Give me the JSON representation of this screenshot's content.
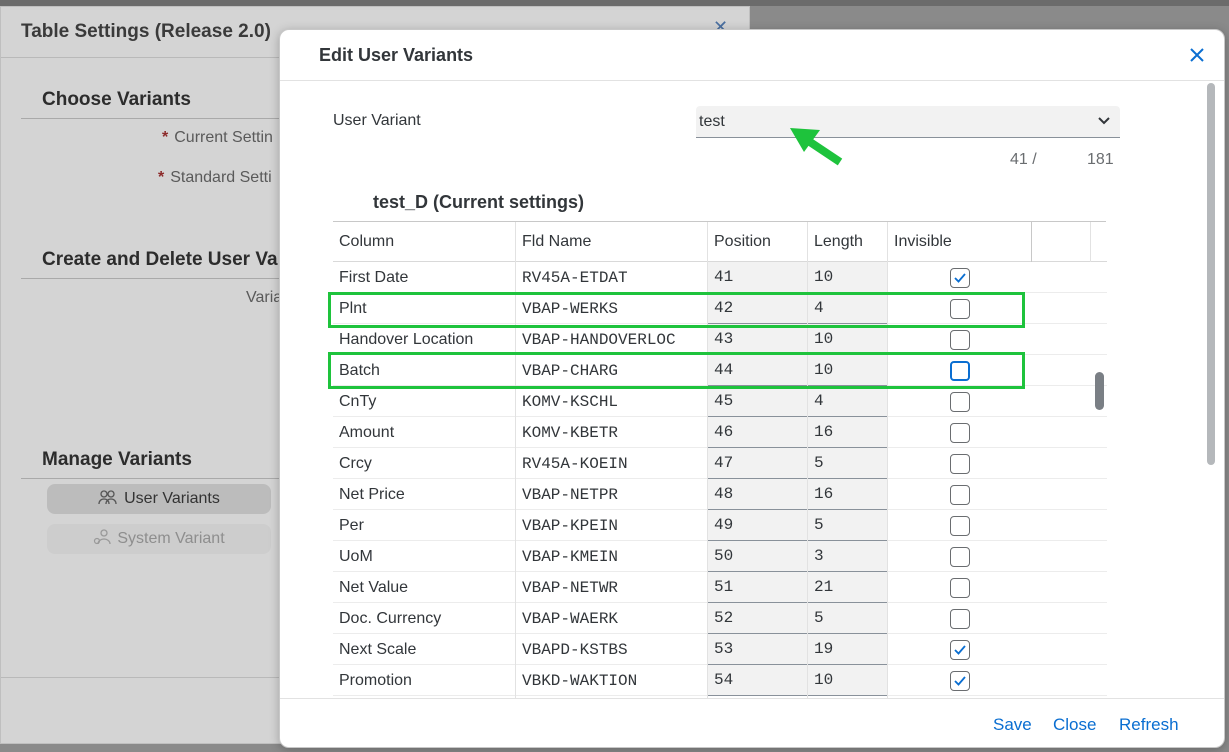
{
  "background_dialog": {
    "title": "Table Settings (Release 2.0)",
    "sections": {
      "choose": "Choose Variants",
      "create": "Create and Delete User Va",
      "manage": "Manage Variants"
    },
    "labels": {
      "current": "Current Settin",
      "standard": "Standard Setti",
      "variant": "Varia",
      "required_mark": "*"
    },
    "buttons": {
      "user_variants": "User Variants",
      "system_variant": "System Variant"
    }
  },
  "dialog": {
    "title": "Edit User Variants",
    "user_variant_label": "User Variant",
    "user_variant_value": "test",
    "counter": {
      "current": "41 /",
      "total": "181"
    },
    "table_title": "test_D (Current settings)",
    "columns": [
      "Column",
      "Fld Name",
      "Position",
      "Length",
      "Invisible"
    ],
    "rows": [
      {
        "column": "First Date",
        "fld": "RV45A-ETDAT",
        "pos": "41",
        "len": "10",
        "invisible": true
      },
      {
        "column": "Plnt",
        "fld": "VBAP-WERKS",
        "pos": "42",
        "len": "4",
        "invisible": false
      },
      {
        "column": "Handover Location",
        "fld": "VBAP-HANDOVERLOC",
        "pos": "43",
        "len": "10",
        "invisible": false
      },
      {
        "column": "Batch",
        "fld": "VBAP-CHARG",
        "pos": "44",
        "len": "10",
        "invisible": false
      },
      {
        "column": "CnTy",
        "fld": "KOMV-KSCHL",
        "pos": "45",
        "len": "4",
        "invisible": false
      },
      {
        "column": "Amount",
        "fld": "KOMV-KBETR",
        "pos": "46",
        "len": "16",
        "invisible": false
      },
      {
        "column": "Crcy",
        "fld": "RV45A-KOEIN",
        "pos": "47",
        "len": "5",
        "invisible": false
      },
      {
        "column": "Net Price",
        "fld": "VBAP-NETPR",
        "pos": "48",
        "len": "16",
        "invisible": false
      },
      {
        "column": "Per",
        "fld": "VBAP-KPEIN",
        "pos": "49",
        "len": "5",
        "invisible": false
      },
      {
        "column": "UoM",
        "fld": "VBAP-KMEIN",
        "pos": "50",
        "len": "3",
        "invisible": false
      },
      {
        "column": "Net Value",
        "fld": "VBAP-NETWR",
        "pos": "51",
        "len": "21",
        "invisible": false
      },
      {
        "column": "Doc. Currency",
        "fld": "VBAP-WAERK",
        "pos": "52",
        "len": "5",
        "invisible": false
      },
      {
        "column": "Next Scale",
        "fld": "VBAPD-KSTBS",
        "pos": "53",
        "len": "19",
        "invisible": true
      },
      {
        "column": "Promotion",
        "fld": "VBKD-WAKTION",
        "pos": "54",
        "len": "10",
        "invisible": true
      }
    ],
    "footer": {
      "save": "Save",
      "close": "Close",
      "refresh": "Refresh"
    }
  },
  "colors": {
    "accent": "#0a6ed1",
    "highlight": "#1ec33c"
  }
}
